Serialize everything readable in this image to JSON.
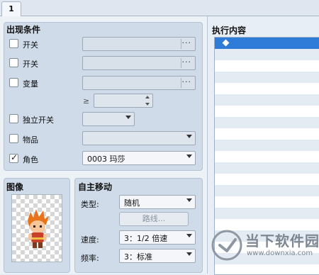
{
  "tabs": [
    {
      "label": "1"
    }
  ],
  "appearance_conditions": {
    "title": "出现条件",
    "rows": [
      {
        "label": "开关",
        "checked": false
      },
      {
        "label": "开关",
        "checked": false
      },
      {
        "label": "变量",
        "checked": false
      }
    ],
    "compare_symbol": "≥",
    "self_switch": {
      "label": "独立开关",
      "checked": false
    },
    "item": {
      "label": "物品",
      "checked": false
    },
    "actor": {
      "label": "角色",
      "checked": true,
      "value": "0003 玛莎"
    },
    "ellipsis": "···"
  },
  "image_panel": {
    "title": "图像"
  },
  "autonomous_movement": {
    "title": "自主移动",
    "type_label": "类型:",
    "type_value": "随机",
    "route_button": "路线...",
    "speed_label": "速度:",
    "speed_value": "3：1/2 倍速",
    "freq_label": "频率:",
    "freq_value": "3：标准"
  },
  "execution": {
    "title": "执行内容"
  },
  "watermark": {
    "brand": "当下软件园",
    "url": "www.downxia.com"
  }
}
